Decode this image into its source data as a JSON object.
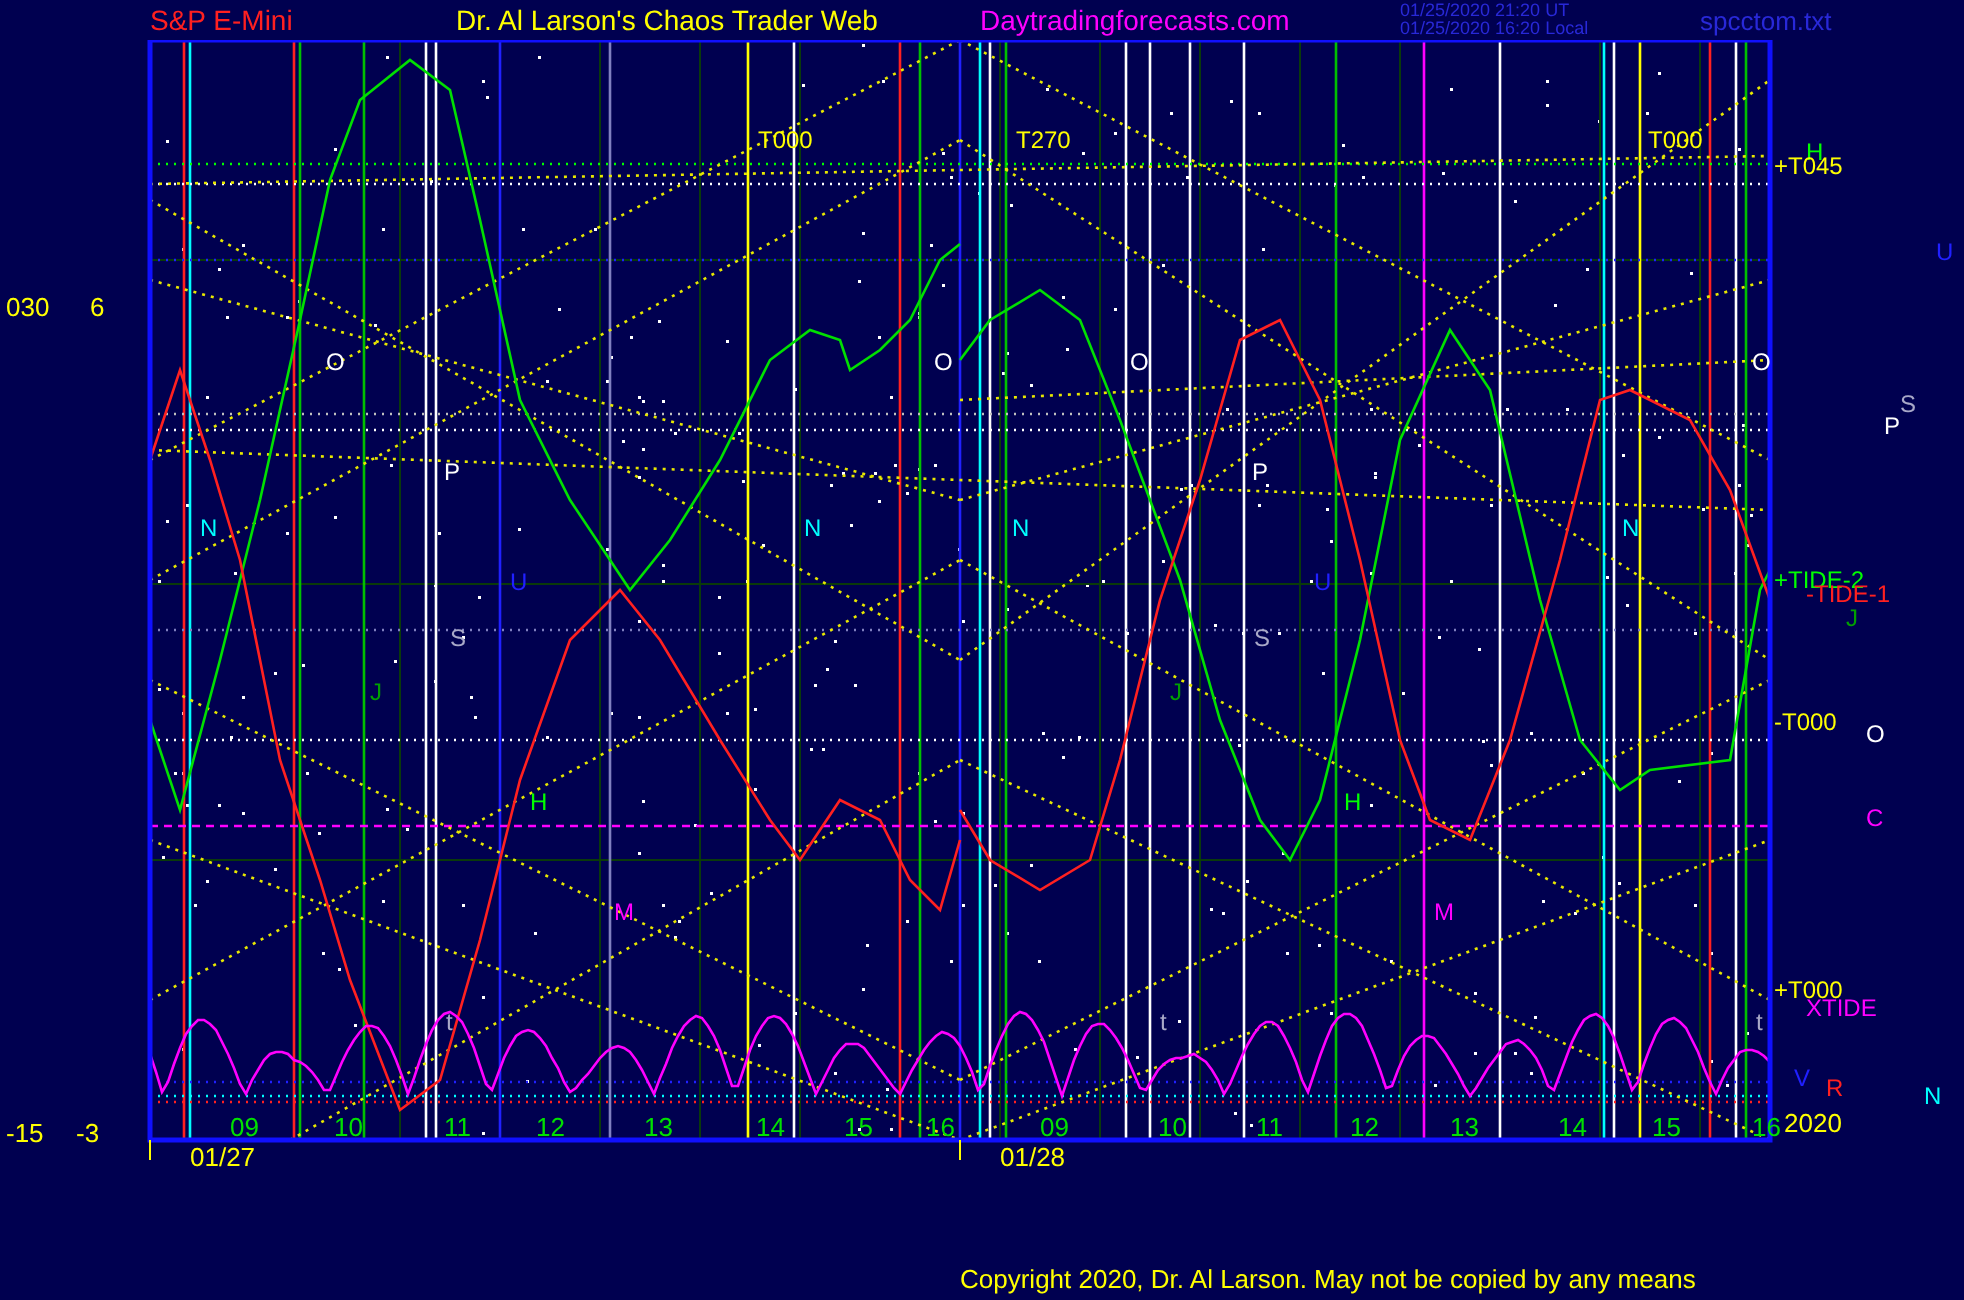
{
  "header": {
    "symbol": "S&P E-Mini",
    "title": "Dr. Al Larson's Chaos Trader Web",
    "site": "Daytradingforecasts.com",
    "timestamps": [
      "01/25/2020 21:20 UT",
      "01/25/2020 16:20 Local"
    ],
    "file": "spcctom.txt"
  },
  "left_scale": [
    "030",
    "6",
    "-15",
    "-3"
  ],
  "chart": {
    "labels": [
      {
        "text": "T000",
        "color": "#ffff00"
      },
      {
        "text": "T270",
        "color": "#ffff00"
      },
      {
        "text": "T000",
        "color": "#ffff00"
      },
      {
        "text": "H",
        "color": "#00ff00"
      },
      {
        "text": "+T045",
        "color": "#ffff00"
      },
      {
        "text": "U",
        "color": "#2020ff"
      },
      {
        "text": "O",
        "color": "#ffffff"
      },
      {
        "text": "O",
        "color": "#ffffff"
      },
      {
        "text": "O",
        "color": "#ffffff"
      },
      {
        "text": "O",
        "color": "#ffffff"
      },
      {
        "text": "S",
        "color": "#a8a8c8"
      },
      {
        "text": "P",
        "color": "#ffffff"
      },
      {
        "text": "P",
        "color": "#ffffff"
      },
      {
        "text": "P",
        "color": "#ffffff"
      },
      {
        "text": "N",
        "color": "#00ffff"
      },
      {
        "text": "N",
        "color": "#00ffff"
      },
      {
        "text": "N",
        "color": "#00ffff"
      },
      {
        "text": "N",
        "color": "#00ffff"
      },
      {
        "text": "U",
        "color": "#2020ff"
      },
      {
        "text": "U",
        "color": "#2020ff"
      },
      {
        "text": "+TIDE-2",
        "color": "#00ff00"
      },
      {
        "text": "-TIDE-1",
        "color": "#ff2020"
      },
      {
        "text": "S",
        "color": "#a8a8c8"
      },
      {
        "text": "S",
        "color": "#a8a8c8"
      },
      {
        "text": "J",
        "color": "#00a000"
      },
      {
        "text": "J",
        "color": "#00a000"
      },
      {
        "text": "J",
        "color": "#00a000"
      },
      {
        "text": "-T000",
        "color": "#ffff00"
      },
      {
        "text": "O",
        "color": "#ffffff"
      },
      {
        "text": "C",
        "color": "#ff00ff"
      },
      {
        "text": "H",
        "color": "#00ff00"
      },
      {
        "text": "H",
        "color": "#00ff00"
      },
      {
        "text": "M",
        "color": "#ff00ff"
      },
      {
        "text": "M",
        "color": "#ff00ff"
      },
      {
        "text": "+T000",
        "color": "#ffff00"
      },
      {
        "text": "XTIDE",
        "color": "#ff00ff"
      },
      {
        "text": "t",
        "color": "#a8a8c8"
      },
      {
        "text": "t",
        "color": "#a8a8c8"
      },
      {
        "text": "t",
        "color": "#a8a8c8"
      },
      {
        "text": "V",
        "color": "#2020ff"
      },
      {
        "text": "R",
        "color": "#ff2020"
      },
      {
        "text": "N",
        "color": "#00ffff"
      }
    ],
    "hour_labels": [
      "09",
      "10",
      "11",
      "12",
      "13",
      "14",
      "15",
      "16",
      "09",
      "10",
      "11",
      "12",
      "13",
      "14",
      "15",
      "16"
    ],
    "date_labels": [
      "01/27",
      "01/28"
    ],
    "year": "2020"
  },
  "footer": {
    "copyright": "Copyright 2020, Dr. Al Larson. May not be copied by any means"
  }
}
